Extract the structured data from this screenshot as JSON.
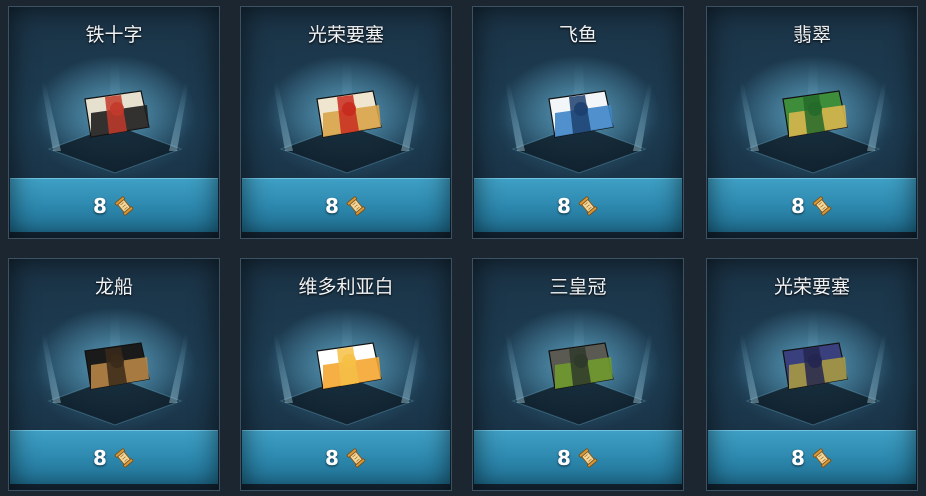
{
  "cards": [
    {
      "title": "铁十字",
      "price": "8",
      "camo_icon": "iron-cross-camo-icon",
      "colors": [
        "#e6e0cf",
        "#1e1e1e",
        "#c23a2a"
      ]
    },
    {
      "title": "光荣要塞",
      "price": "8",
      "camo_icon": "glorious-fortress-camo-icon",
      "colors": [
        "#f0e6cf",
        "#d8a44a",
        "#c82a1e"
      ]
    },
    {
      "title": "飞鱼",
      "price": "8",
      "camo_icon": "flying-fish-camo-icon",
      "colors": [
        "#f3f6f9",
        "#3e86c8",
        "#1c3f6e"
      ]
    },
    {
      "title": "翡翠",
      "price": "8",
      "camo_icon": "emerald-camo-icon",
      "colors": [
        "#3e8d3a",
        "#d8b54e",
        "#246a2a"
      ]
    },
    {
      "title": "龙船",
      "price": "8",
      "camo_icon": "dragon-boat-camo-icon",
      "colors": [
        "#1a1a1a",
        "#b68546",
        "#3a2a1a"
      ]
    },
    {
      "title": "维多利亚白",
      "price": "8",
      "camo_icon": "victoria-white-camo-icon",
      "colors": [
        "#ffffff",
        "#f5a630",
        "#f5c045"
      ]
    },
    {
      "title": "三皇冠",
      "price": "8",
      "camo_icon": "three-crowns-camo-icon",
      "colors": [
        "#5a5a52",
        "#6f9a2e",
        "#2f3a2a"
      ]
    },
    {
      "title": "光荣要塞",
      "price": "8",
      "camo_icon": "glorious-fortress-camo-icon",
      "colors": [
        "#3a3f7e",
        "#a99a45",
        "#242650"
      ]
    }
  ],
  "currency_icon": "doubloon-scroll-icon"
}
